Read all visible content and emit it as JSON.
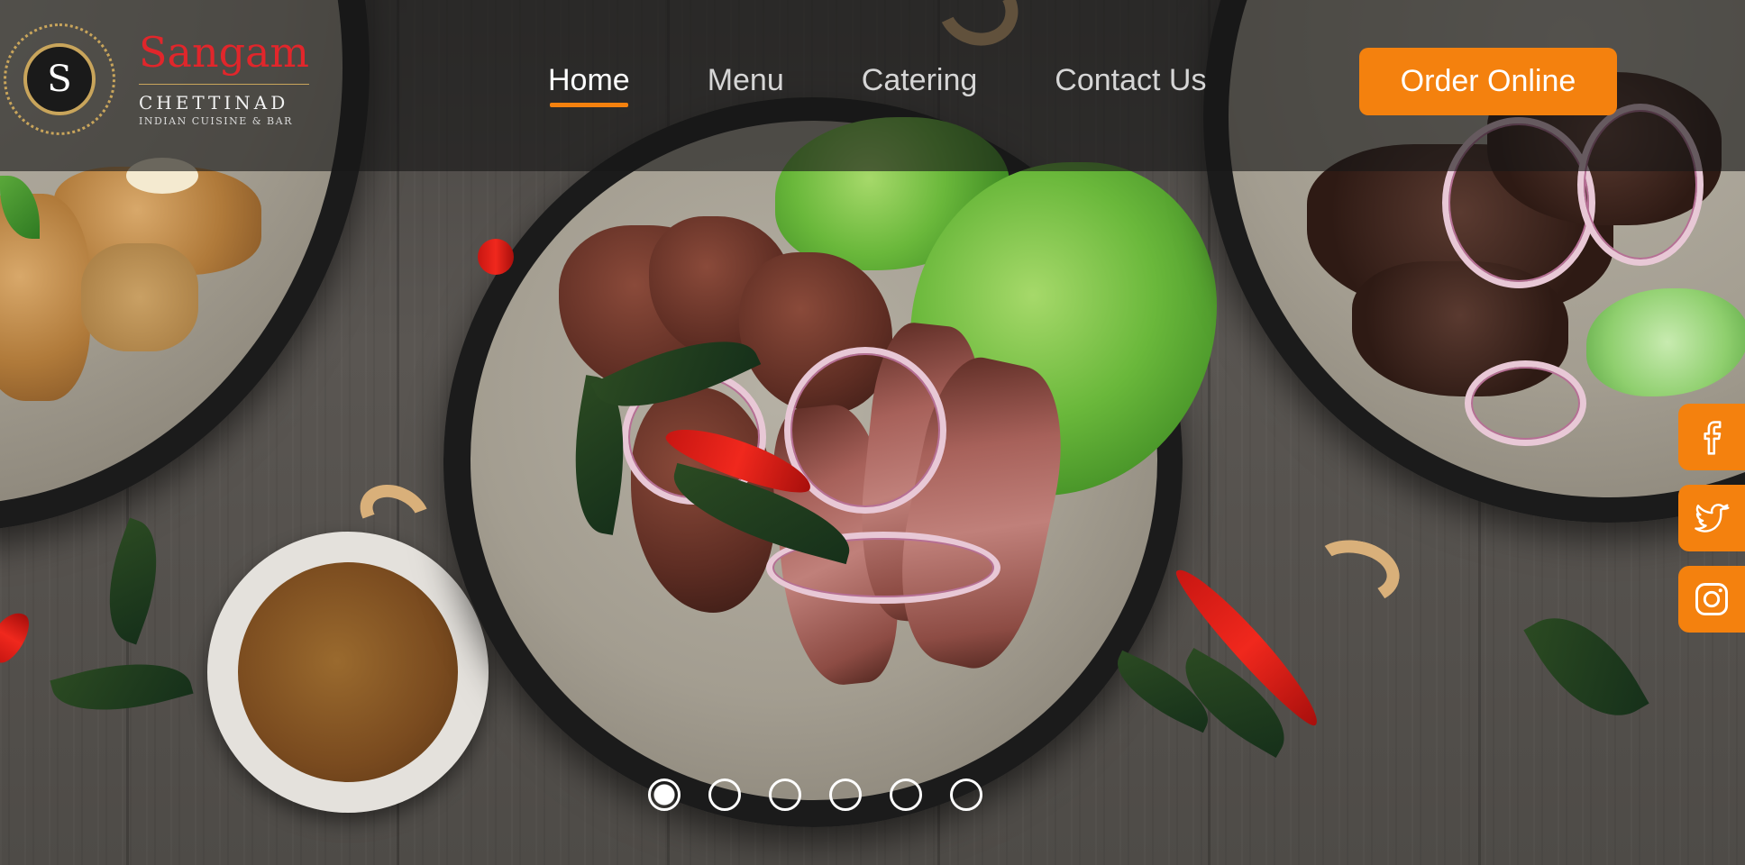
{
  "brand": {
    "name": "Sangam",
    "subtitle": "CHETTINAD",
    "tagline": "INDIAN CUISINE & BAR",
    "monogram": "S",
    "colors": {
      "primary": "#f4810e",
      "brand_red": "#e1262b",
      "gold": "#c9a55b"
    }
  },
  "nav": {
    "items": [
      {
        "label": "Home",
        "active": true
      },
      {
        "label": "Menu",
        "active": false
      },
      {
        "label": "Catering",
        "active": false
      },
      {
        "label": "Contact Us",
        "active": false
      }
    ],
    "cta_label": "Order Online"
  },
  "social": [
    {
      "icon": "facebook-icon"
    },
    {
      "icon": "twitter-icon"
    },
    {
      "icon": "instagram-icon"
    }
  ],
  "carousel": {
    "slide_count": 6,
    "active_index": 0
  }
}
